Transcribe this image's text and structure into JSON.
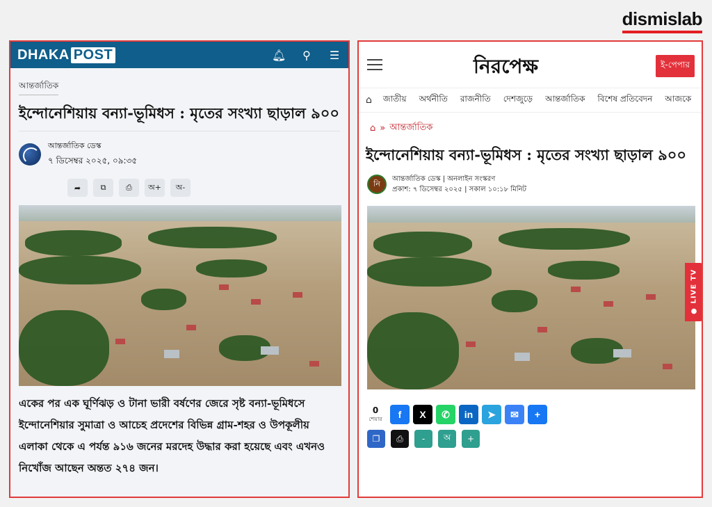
{
  "brand": {
    "name": "dismislab"
  },
  "left": {
    "logo_a": "DHAKA",
    "logo_b": "POST",
    "category": "আন্তর্জাতিক",
    "title": "ইন্দোনেশিয়ায় বন্যা-ভূমিধস : মৃতের সংখ্যা ছাড়াল ৯০০",
    "author": "আন্তর্জাতিক ডেস্ক",
    "date": "৭ ডিসেম্বর ২০২৫, ০৯:৩৫",
    "tools": [
      "➦",
      "⧉",
      "⎙",
      "অ+",
      "অ-"
    ],
    "body": "একের পর এক ঘূর্ণিঝড় ও টানা ভারী বর্ষণের জেরে সৃষ্ট বন্যা-ভূমিধসে ইন্দোনেশিয়ার সুমাত্রা ও আচেহ প্রদেশের বিভিন্ন গ্রাম-শহর ও উপকূলীয় এলাকা থেকে এ পর্যন্ত ৯১৬ জনের মরদেহ উদ্ধার করা হয়েছে এবং এখনও নিখোঁজ আছেন অন্তত ২৭৪ জন।"
  },
  "right": {
    "logo": "নিরপেক্ষ",
    "epaper": "ই-পেপার",
    "nav": [
      "জাতীয়",
      "অর্থনীতি",
      "রাজনীতি",
      "দেশজুড়ে",
      "আন্তর্জাতিক",
      "বিশেষ প্রতিবেদন",
      "আজকে"
    ],
    "breadcrumb": "আন্তর্জাতিক",
    "title": "ইন্দোনেশিয়ায় বন্যা-ভূমিধস : মৃতের সংখ্যা ছাড়াল ৯০০",
    "avatar": "নি",
    "meta1": "আন্তর্জাতিক ডেস্ক | অনলাইন সংস্করণ",
    "meta2": "প্রকাশ: ৭ ডিসেম্বর ২০২৫ | সকাল ১০:১৮ মিনিট",
    "live_tv": "● LIVE TV",
    "share_count": "0",
    "share_label": "শেয়ার",
    "share_buttons": [
      {
        "label": "f",
        "color": "#1877f2"
      },
      {
        "label": "X",
        "color": "#000000"
      },
      {
        "label": "✆",
        "color": "#25d366"
      },
      {
        "label": "in",
        "color": "#0a66c2"
      },
      {
        "label": "➤",
        "color": "#2aa3de"
      },
      {
        "label": "✉",
        "color": "#3b82f6"
      },
      {
        "label": "+",
        "color": "#1877f2"
      }
    ],
    "tool_buttons": [
      {
        "label": "❐",
        "color": "#2f67c7"
      },
      {
        "label": "⎙",
        "color": "#111111"
      },
      {
        "label": "-",
        "color": "#2f9f8f"
      },
      {
        "label": "অ",
        "color": "#2f9f8f"
      },
      {
        "label": "+",
        "color": "#2f9f8f"
      }
    ]
  }
}
